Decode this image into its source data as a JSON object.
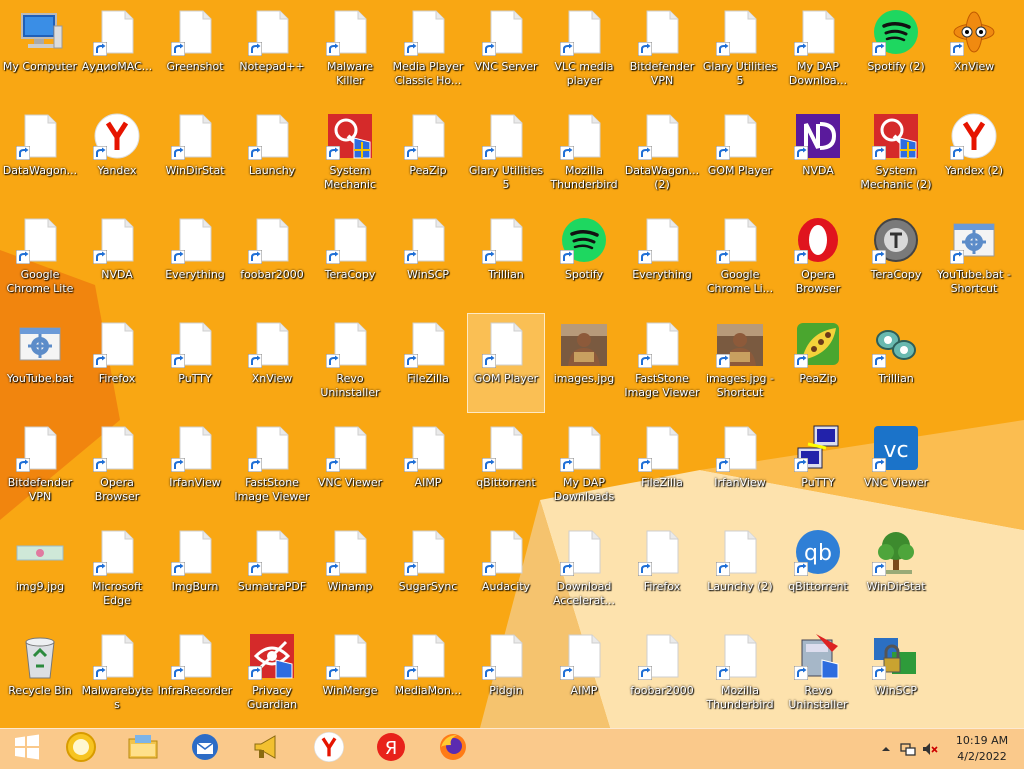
{
  "desktop": {
    "icons": [
      {
        "label": "My Computer",
        "icon": "computer-icon",
        "shortcut": false
      },
      {
        "label": "АудиоMAC...",
        "icon": "file-icon",
        "shortcut": true
      },
      {
        "label": "Greenshot",
        "icon": "file-icon",
        "shortcut": true
      },
      {
        "label": "Notepad++",
        "icon": "file-icon",
        "shortcut": true
      },
      {
        "label": "Malware Killer",
        "icon": "file-icon",
        "shortcut": true
      },
      {
        "label": "Media Player Classic Ho...",
        "icon": "file-icon",
        "shortcut": true
      },
      {
        "label": "VNC Server",
        "icon": "file-icon",
        "shortcut": true
      },
      {
        "label": "VLC media player",
        "icon": "file-icon",
        "shortcut": true
      },
      {
        "label": "Bitdefender VPN",
        "icon": "file-icon",
        "shortcut": true
      },
      {
        "label": "Glary Utilities 5",
        "icon": "file-icon",
        "shortcut": true
      },
      {
        "label": "My DAP Downloa...",
        "icon": "file-icon",
        "shortcut": true
      },
      {
        "label": "Spotify (2)",
        "icon": "spotify-icon",
        "shortcut": true
      },
      {
        "label": "XnView",
        "icon": "xnview-icon",
        "shortcut": true
      },
      {
        "label": "DataWagon...",
        "icon": "file-icon",
        "shortcut": true
      },
      {
        "label": "Yandex",
        "icon": "yandex-icon",
        "shortcut": true
      },
      {
        "label": "WinDirStat",
        "icon": "file-icon",
        "shortcut": true
      },
      {
        "label": "Launchy",
        "icon": "file-icon",
        "shortcut": true
      },
      {
        "label": "System Mechanic",
        "icon": "system-mechanic-icon",
        "shortcut": true
      },
      {
        "label": "PeaZip",
        "icon": "file-icon",
        "shortcut": true
      },
      {
        "label": "Glary Utilities 5",
        "icon": "file-icon",
        "shortcut": true
      },
      {
        "label": "Mozilla Thunderbird",
        "icon": "file-icon",
        "shortcut": true
      },
      {
        "label": "DataWagon... (2)",
        "icon": "file-icon",
        "shortcut": true
      },
      {
        "label": "GOM Player",
        "icon": "file-icon",
        "shortcut": true
      },
      {
        "label": "NVDA",
        "icon": "nvda-icon",
        "shortcut": true
      },
      {
        "label": "System Mechanic (2)",
        "icon": "system-mechanic-icon",
        "shortcut": true
      },
      {
        "label": "Yandex (2)",
        "icon": "yandex-icon",
        "shortcut": true
      },
      {
        "label": "Google Chrome Lite",
        "icon": "file-icon",
        "shortcut": true
      },
      {
        "label": "NVDA",
        "icon": "file-icon",
        "shortcut": true
      },
      {
        "label": "Everything",
        "icon": "file-icon",
        "shortcut": true
      },
      {
        "label": "foobar2000",
        "icon": "file-icon",
        "shortcut": true
      },
      {
        "label": "TeraCopy",
        "icon": "file-icon",
        "shortcut": true
      },
      {
        "label": "WinSCP",
        "icon": "file-icon",
        "shortcut": true
      },
      {
        "label": "Trillian",
        "icon": "file-icon",
        "shortcut": true
      },
      {
        "label": "Spotify",
        "icon": "spotify-icon",
        "shortcut": true
      },
      {
        "label": "Everything",
        "icon": "file-icon",
        "shortcut": true
      },
      {
        "label": "Google Chrome Li...",
        "icon": "file-icon",
        "shortcut": true
      },
      {
        "label": "Opera Browser",
        "icon": "opera-icon",
        "shortcut": true
      },
      {
        "label": "TeraCopy",
        "icon": "teracopy-icon",
        "shortcut": true
      },
      {
        "label": "YouTube.bat - Shortcut",
        "icon": "batch-file-icon",
        "shortcut": true
      },
      {
        "label": "YouTube.bat",
        "icon": "batch-file-icon",
        "shortcut": false
      },
      {
        "label": "Firefox",
        "icon": "file-icon",
        "shortcut": true
      },
      {
        "label": "PuTTY",
        "icon": "file-icon",
        "shortcut": true
      },
      {
        "label": "XnView",
        "icon": "file-icon",
        "shortcut": true
      },
      {
        "label": "Revo Uninstaller",
        "icon": "file-icon",
        "shortcut": true
      },
      {
        "label": "FileZilla",
        "icon": "file-icon",
        "shortcut": true
      },
      {
        "label": "GOM Player",
        "icon": "file-icon",
        "shortcut": true,
        "selected": true
      },
      {
        "label": "images.jpg",
        "icon": "photo-thumbnail-icon",
        "shortcut": false
      },
      {
        "label": "FastStone Image Viewer",
        "icon": "file-icon",
        "shortcut": true
      },
      {
        "label": "images.jpg - Shortcut",
        "icon": "photo-thumbnail-icon",
        "shortcut": true
      },
      {
        "label": "PeaZip",
        "icon": "peazip-icon",
        "shortcut": true
      },
      {
        "label": "Trillian",
        "icon": "trillian-icon",
        "shortcut": true
      },
      {
        "label": "Bitdefender VPN",
        "icon": "file-icon",
        "shortcut": true
      },
      {
        "label": "Opera Browser",
        "icon": "file-icon",
        "shortcut": true
      },
      {
        "label": "IrfanView",
        "icon": "file-icon",
        "shortcut": true
      },
      {
        "label": "FastStone Image Viewer",
        "icon": "file-icon",
        "shortcut": true
      },
      {
        "label": "VNC Viewer",
        "icon": "file-icon",
        "shortcut": true
      },
      {
        "label": "AIMP",
        "icon": "file-icon",
        "shortcut": true
      },
      {
        "label": "qBittorrent",
        "icon": "file-icon",
        "shortcut": true
      },
      {
        "label": "My DAP Downloads",
        "icon": "file-icon",
        "shortcut": true
      },
      {
        "label": "FileZilla",
        "icon": "file-icon",
        "shortcut": true
      },
      {
        "label": "IrfanView",
        "icon": "file-icon",
        "shortcut": true
      },
      {
        "label": "PuTTY",
        "icon": "putty-icon",
        "shortcut": true
      },
      {
        "label": "VNC Viewer",
        "icon": "vnc-viewer-icon",
        "shortcut": true
      },
      {
        "label": "img9.jpg",
        "icon": "image-strip-icon",
        "shortcut": false
      },
      {
        "label": "Microsoft Edge",
        "icon": "file-icon",
        "shortcut": true
      },
      {
        "label": "ImgBurn",
        "icon": "file-icon",
        "shortcut": true
      },
      {
        "label": "SumatraPDF",
        "icon": "file-icon",
        "shortcut": true
      },
      {
        "label": "Winamp",
        "icon": "file-icon",
        "shortcut": true
      },
      {
        "label": "SugarSync",
        "icon": "file-icon",
        "shortcut": true
      },
      {
        "label": "Audacity",
        "icon": "file-icon",
        "shortcut": true
      },
      {
        "label": "Download Accelerat...",
        "icon": "file-icon",
        "shortcut": true
      },
      {
        "label": "Firefox",
        "icon": "file-icon",
        "shortcut": true
      },
      {
        "label": "Launchy (2)",
        "icon": "file-icon",
        "shortcut": true
      },
      {
        "label": "qBittorrent",
        "icon": "qbittorrent-icon",
        "shortcut": true
      },
      {
        "label": "WinDirStat",
        "icon": "tree-icon",
        "shortcut": true
      },
      {
        "label": "Recycle Bin",
        "icon": "recycle-bin-icon",
        "shortcut": false
      },
      {
        "label": "Malwarebytes",
        "icon": "file-icon",
        "shortcut": true
      },
      {
        "label": "InfraRecorder",
        "icon": "file-icon",
        "shortcut": true
      },
      {
        "label": "Privacy Guardian",
        "icon": "privacy-guardian-icon",
        "shortcut": true
      },
      {
        "label": "WinMerge",
        "icon": "file-icon",
        "shortcut": true
      },
      {
        "label": "MediaMon...",
        "icon": "file-icon",
        "shortcut": true
      },
      {
        "label": "Pidgin",
        "icon": "file-icon",
        "shortcut": true
      },
      {
        "label": "AIMP",
        "icon": "file-icon",
        "shortcut": true
      },
      {
        "label": "foobar2000",
        "icon": "file-icon",
        "shortcut": true
      },
      {
        "label": "Mozilla Thunderbird",
        "icon": "file-icon",
        "shortcut": true
      },
      {
        "label": "Revo Uninstaller",
        "icon": "revo-uninstaller-icon",
        "shortcut": true
      },
      {
        "label": "WinSCP",
        "icon": "winscp-icon",
        "shortcut": true
      }
    ]
  },
  "taskbar": {
    "buttons": [
      {
        "name": "start-button",
        "icon": "windows-logo-icon"
      },
      {
        "name": "taskbar-app-chrome-lite",
        "icon": "yellow-circle-icon"
      },
      {
        "name": "taskbar-app-file-explorer",
        "icon": "folder-icon"
      },
      {
        "name": "taskbar-app-thunderbird",
        "icon": "thunderbird-icon"
      },
      {
        "name": "taskbar-app-megaphone",
        "icon": "megaphone-icon"
      },
      {
        "name": "taskbar-app-yandex",
        "icon": "yandex-icon"
      },
      {
        "name": "taskbar-app-yandex-browser",
        "icon": "yandex-ya-icon"
      },
      {
        "name": "taskbar-app-firefox",
        "icon": "firefox-icon"
      }
    ],
    "tray": {
      "time": "10:19 AM",
      "date": "4/2/2022"
    }
  },
  "colors": {
    "wallpaper": "#f9a713",
    "wallpaper_dark": "#f07f0e",
    "wallpaper_light": "#fde2ad",
    "taskbar": "#facc96"
  }
}
